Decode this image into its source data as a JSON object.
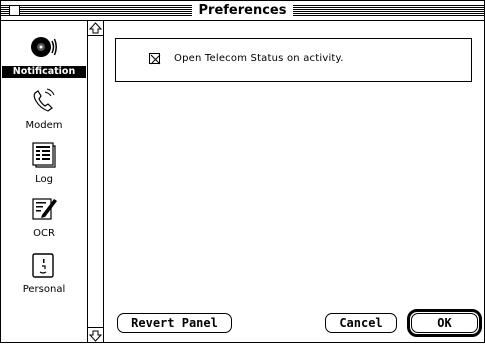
{
  "window": {
    "title": "Preferences"
  },
  "sidebar": {
    "items": [
      {
        "label": "Notification",
        "icon": "speaker-icon",
        "selected": true
      },
      {
        "label": "Modem",
        "icon": "phone-icon",
        "selected": false
      },
      {
        "label": "Log",
        "icon": "document-list-icon",
        "selected": false
      },
      {
        "label": "OCR",
        "icon": "pen-document-icon",
        "selected": false
      },
      {
        "label": "Personal",
        "icon": "person-face-icon",
        "selected": false
      }
    ]
  },
  "panel": {
    "option_label": "Open Telecom Status on activity.",
    "option_checked": true
  },
  "buttons": {
    "revert": "Revert Panel",
    "cancel": "Cancel",
    "ok": "OK"
  }
}
